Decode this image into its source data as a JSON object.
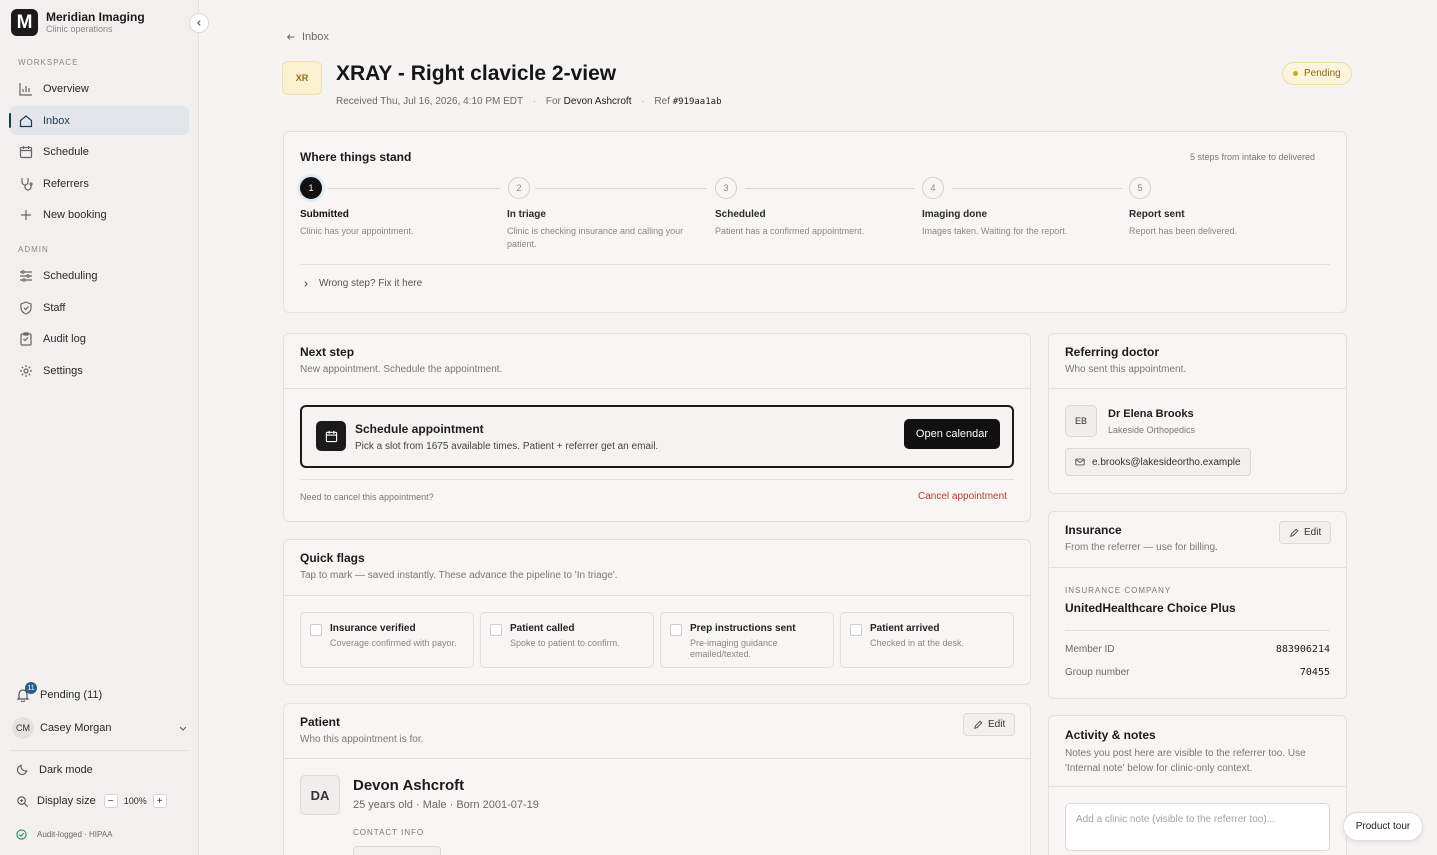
{
  "brand": {
    "name": "Meridian Imaging",
    "subtitle": "Clinic operations",
    "logo_letter": "M"
  },
  "sidebar": {
    "workspace_label": "WORKSPACE",
    "workspace_items": [
      {
        "label": "Overview",
        "icon": "chart-icon"
      },
      {
        "label": "Inbox",
        "icon": "home-icon",
        "active": true
      },
      {
        "label": "Schedule",
        "icon": "calendar-icon"
      },
      {
        "label": "Referrers",
        "icon": "stethoscope-icon"
      },
      {
        "label": "New booking",
        "icon": "plus-icon"
      }
    ],
    "admin_label": "ADMIN",
    "admin_items": [
      {
        "label": "Scheduling",
        "icon": "sliders-icon"
      },
      {
        "label": "Staff",
        "icon": "shield-icon"
      },
      {
        "label": "Audit log",
        "icon": "clipboard-icon"
      },
      {
        "label": "Settings",
        "icon": "gear-icon"
      }
    ],
    "pending": {
      "label": "Pending (11)",
      "badge": "11"
    },
    "user": {
      "initials": "CM",
      "name": "Casey Morgan"
    },
    "dark_mode": "Dark mode",
    "display_size": {
      "label": "Display size",
      "minus": "−",
      "value": "100%",
      "plus": "+"
    },
    "audit": "Audit-logged · HIPAA"
  },
  "header": {
    "back": "Inbox",
    "type_badge": "XR",
    "title": "XRAY - Right clavicle 2-view",
    "received": "Received Thu, Jul 16, 2026, 4:10 PM EDT",
    "for_label": "For",
    "for_name": "Devon Ashcroft",
    "ref_label": "Ref",
    "ref_value": "#919aa1ab",
    "status": "Pending",
    "dot_sep": "·"
  },
  "progress": {
    "title": "Where things stand",
    "summary": "5 steps from intake to delivered",
    "steps": [
      {
        "num": "1",
        "label": "Submitted",
        "desc": "Clinic has your appointment.",
        "done": true
      },
      {
        "num": "2",
        "label": "In triage",
        "desc": "Clinic is checking insurance and calling your patient."
      },
      {
        "num": "3",
        "label": "Scheduled",
        "desc": "Patient has a confirmed appointment."
      },
      {
        "num": "4",
        "label": "Imaging done",
        "desc": "Images taken. Waiting for the report."
      },
      {
        "num": "5",
        "label": "Report sent",
        "desc": "Report has been delivered."
      }
    ],
    "fix_link": "Wrong step? Fix it here"
  },
  "next_step": {
    "title": "Next step",
    "subtitle": "New appointment. Schedule the appointment.",
    "action_title": "Schedule appointment",
    "action_desc": "Pick a slot from 1675 available times. Patient + referrer get an email.",
    "button": "Open calendar",
    "cancel_question": "Need to cancel this appointment?",
    "cancel_link": "Cancel appointment"
  },
  "quick_flags": {
    "title": "Quick flags",
    "subtitle": "Tap to mark — saved instantly. These advance the pipeline to 'In triage'.",
    "flags": [
      {
        "title": "Insurance verified",
        "desc": "Coverage confirmed with payor."
      },
      {
        "title": "Patient called",
        "desc": "Spoke to patient to confirm."
      },
      {
        "title": "Prep instructions sent",
        "desc": "Pre-imaging guidance emailed/texted."
      },
      {
        "title": "Patient arrived",
        "desc": "Checked in at the desk."
      }
    ]
  },
  "patient": {
    "title": "Patient",
    "subtitle": "Who this appointment is for.",
    "edit": "Edit",
    "initials": "DA",
    "name": "Devon Ashcroft",
    "details": "25 years old · Male · Born 2001-07-19",
    "contact_label": "CONTACT INFO"
  },
  "referring": {
    "title": "Referring doctor",
    "subtitle": "Who sent this appointment.",
    "initials": "EB",
    "name": "Dr Elena Brooks",
    "practice": "Lakeside Orthopedics",
    "email": "e.brooks@lakesideortho.example"
  },
  "insurance": {
    "title": "Insurance",
    "subtitle": "From the referrer — use for billing.",
    "edit": "Edit",
    "company_label": "INSURANCE COMPANY",
    "company": "UnitedHealthcare Choice Plus",
    "member_label": "Member ID",
    "member_id": "883906214",
    "group_label": "Group number",
    "group_number": "70455"
  },
  "activity": {
    "title": "Activity & notes",
    "subtitle": "Notes you post here are visible to the referrer too. Use 'Internal note' below for clinic-only context.",
    "placeholder": "Add a clinic note (visible to the referrer too)..."
  },
  "product_tour": "Product tour",
  "colors": {
    "accent": "#1b3a58",
    "danger": "#c0392b",
    "pending_bg": "#fcf4dc",
    "pending_text": "#8a6a12"
  }
}
